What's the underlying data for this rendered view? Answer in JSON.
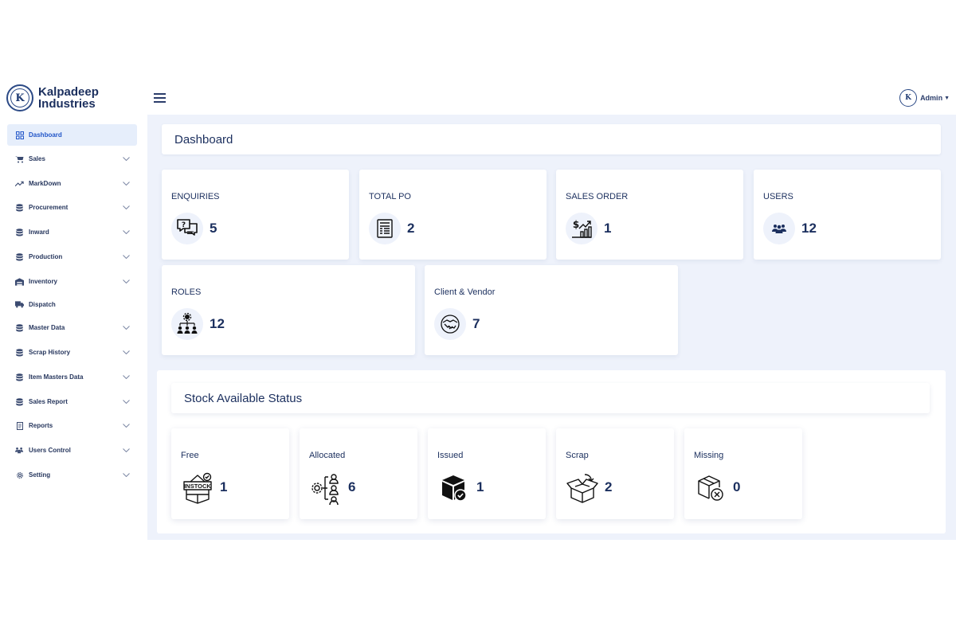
{
  "brand": {
    "line1": "Kalpadeep",
    "line2": "Industries",
    "logo_letter": "K"
  },
  "header": {
    "user": "Admin",
    "avatar_letter": "K"
  },
  "sidebar": {
    "items": [
      {
        "label": "Dashboard",
        "icon": "grid-icon"
      },
      {
        "label": "Sales",
        "icon": "cart-icon"
      },
      {
        "label": "MarkDown",
        "icon": "trend-icon"
      },
      {
        "label": "Procurement",
        "icon": "database-icon"
      },
      {
        "label": "Inward",
        "icon": "database-icon"
      },
      {
        "label": "Production",
        "icon": "database-icon"
      },
      {
        "label": "Inventory",
        "icon": "warehouse-icon"
      },
      {
        "label": "Dispatch",
        "icon": "truck-icon"
      },
      {
        "label": "Master Data",
        "icon": "database-icon"
      },
      {
        "label": "Scrap History",
        "icon": "database-icon"
      },
      {
        "label": "Item Masters Data",
        "icon": "database-icon"
      },
      {
        "label": "Sales Report",
        "icon": "database-icon"
      },
      {
        "label": "Reports",
        "icon": "document-icon"
      },
      {
        "label": "Users Control",
        "icon": "users-icon"
      },
      {
        "label": "Setting",
        "icon": "gear-icon"
      }
    ]
  },
  "page": {
    "title": "Dashboard"
  },
  "stats": [
    {
      "label": "ENQUIRIES",
      "value": "5",
      "icon": "chat-question-icon"
    },
    {
      "label": "TOTAL PO",
      "value": "2",
      "icon": "document-icon"
    },
    {
      "label": "SALES ORDER",
      "value": "1",
      "icon": "sales-growth-icon"
    },
    {
      "label": "USERS",
      "value": "12",
      "icon": "users-icon"
    },
    {
      "label": "ROLES",
      "value": "12",
      "icon": "roles-icon"
    },
    {
      "label": "Client & Vendor",
      "value": "7",
      "icon": "handshake-icon"
    }
  ],
  "stock": {
    "title": "Stock Available Status",
    "items": [
      {
        "label": "Free",
        "value": "1",
        "icon": "instock-icon",
        "icon_text": "INSTOCK"
      },
      {
        "label": "Allocated",
        "value": "6",
        "icon": "allocated-icon"
      },
      {
        "label": "Issued",
        "value": "1",
        "icon": "box-check-icon"
      },
      {
        "label": "Scrap",
        "value": "2",
        "icon": "open-box-icon"
      },
      {
        "label": "Missing",
        "value": "0",
        "icon": "box-cross-icon"
      }
    ]
  },
  "colors": {
    "primary": "#1b2f5e",
    "active": "#2256c8",
    "background": "#eef2fb"
  }
}
